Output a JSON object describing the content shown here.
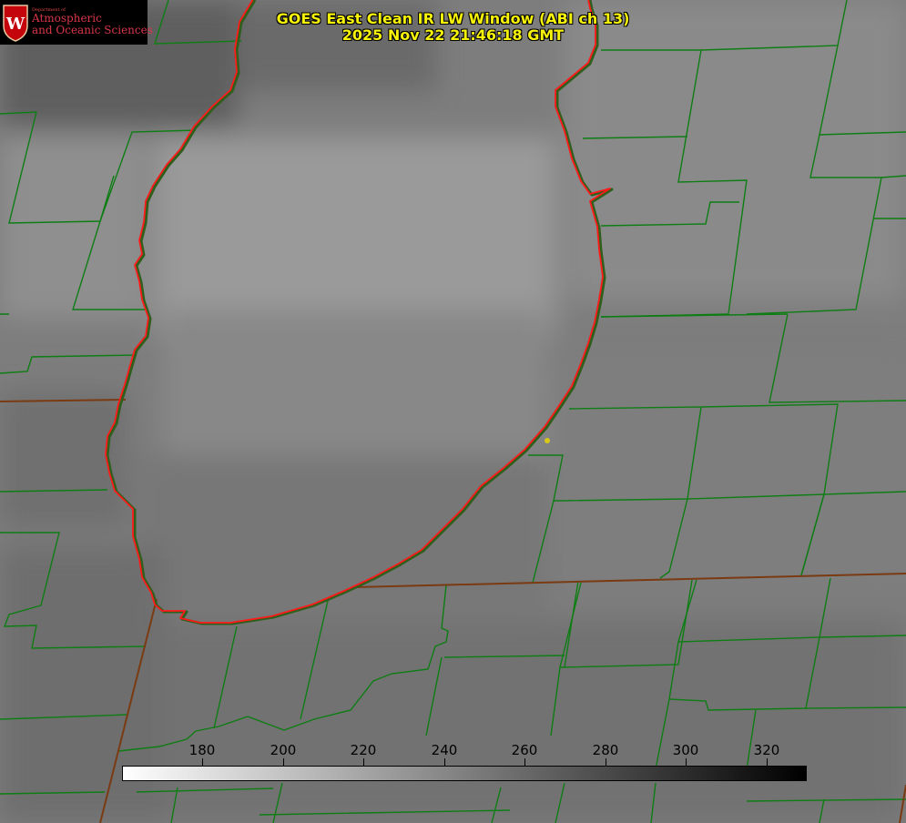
{
  "logo": {
    "department": "Department of",
    "line1": "Atmospheric",
    "line2": "and Oceanic Sciences",
    "seal_letter": "W"
  },
  "title": {
    "line1": "GOES East Clean IR LW Window (ABI ch 13)",
    "line2": "2025 Nov 22 21:46:18 GMT"
  },
  "colorbar": {
    "min": 160,
    "max": 330,
    "ticks": [
      180,
      200,
      220,
      240,
      260,
      280,
      300,
      320
    ],
    "gradient": [
      "#ffffff",
      "#000000"
    ]
  },
  "colors": {
    "background": "#7c7c7c",
    "county_lines": "#0e7d14",
    "state_lines": "#7a3a12",
    "coastline": "#ff1a1a",
    "title_text": "#f6f20a",
    "station_marker": "#d8c81a",
    "logo_text": "#d8374a"
  }
}
